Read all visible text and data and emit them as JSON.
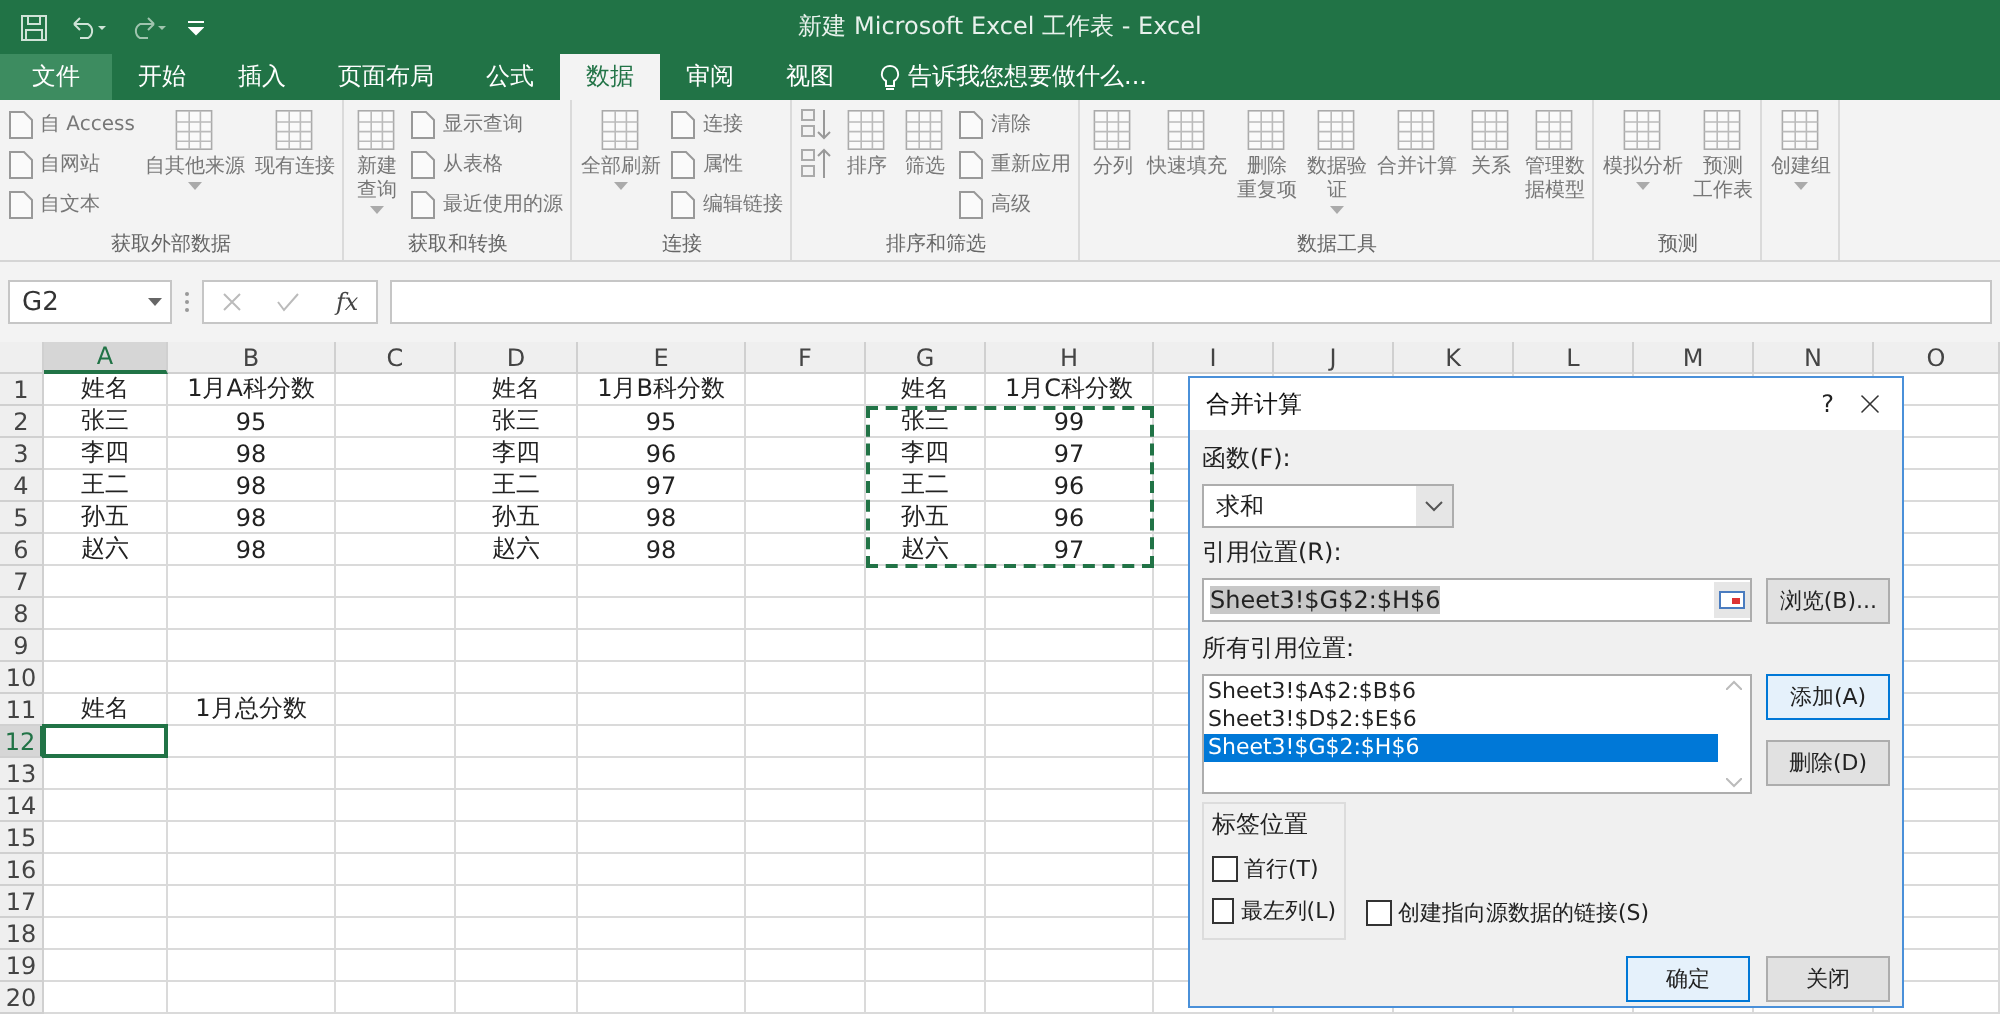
{
  "window": {
    "title": "新建 Microsoft Excel 工作表 - Excel"
  },
  "tabs": [
    {
      "label": "文件",
      "kind": "file",
      "selected": false
    },
    {
      "label": "开始",
      "kind": "tab",
      "selected": false
    },
    {
      "label": "插入",
      "kind": "tab",
      "selected": false
    },
    {
      "label": "页面布局",
      "kind": "tab",
      "selected": false
    },
    {
      "label": "公式",
      "kind": "tab",
      "selected": false
    },
    {
      "label": "数据",
      "kind": "tab",
      "selected": true
    },
    {
      "label": "审阅",
      "kind": "tab",
      "selected": false
    },
    {
      "label": "视图",
      "kind": "tab",
      "selected": false
    }
  ],
  "tell_me": {
    "placeholder": "告诉我您想要做什么..."
  },
  "ribbon": [
    {
      "label": "获取外部数据",
      "items": [
        {
          "kind": "stack",
          "items": [
            "自 Access",
            "自网站",
            "自文本"
          ]
        },
        {
          "kind": "big",
          "label": "自其他来源",
          "dropdown": true
        },
        {
          "kind": "big",
          "label": "现有连接",
          "dropdown": false
        }
      ]
    },
    {
      "label": "获取和转换",
      "items": [
        {
          "kind": "big",
          "lines": [
            "新建",
            "查询"
          ],
          "dropdown": true
        },
        {
          "kind": "stack",
          "items": [
            "显示查询",
            "从表格",
            "最近使用的源"
          ]
        }
      ]
    },
    {
      "label": "连接",
      "items": [
        {
          "kind": "big",
          "label": "全部刷新",
          "dropdown": true
        },
        {
          "kind": "stack",
          "items": [
            "连接",
            "属性",
            "编辑链接"
          ]
        }
      ]
    },
    {
      "label": "排序和筛选",
      "items": [
        {
          "kind": "sort"
        },
        {
          "kind": "big",
          "label": "排序",
          "dropdown": false
        },
        {
          "kind": "big",
          "label": "筛选",
          "dropdown": false
        },
        {
          "kind": "stack",
          "items": [
            "清除",
            "重新应用",
            "高级"
          ]
        }
      ]
    },
    {
      "label": "数据工具",
      "items": [
        {
          "kind": "big",
          "label": "分列",
          "dropdown": false
        },
        {
          "kind": "big",
          "label": "快速填充",
          "dropdown": false
        },
        {
          "kind": "big",
          "lines": [
            "删除",
            "重复项"
          ],
          "dropdown": false
        },
        {
          "kind": "big",
          "lines": [
            "数据验",
            "证"
          ],
          "dropdown": true
        },
        {
          "kind": "big",
          "label": "合并计算",
          "dropdown": false
        },
        {
          "kind": "big",
          "label": "关系",
          "dropdown": false
        },
        {
          "kind": "big",
          "lines": [
            "管理数",
            "据模型"
          ],
          "dropdown": false
        }
      ]
    },
    {
      "label": "预测",
      "items": [
        {
          "kind": "big",
          "label": "模拟分析",
          "dropdown": true
        },
        {
          "kind": "big",
          "lines": [
            "预测",
            "工作表"
          ],
          "dropdown": false
        }
      ]
    },
    {
      "items": [
        {
          "kind": "big",
          "label": "创建组",
          "dropdown": true
        }
      ]
    }
  ],
  "formula_bar": {
    "name_box": "G2",
    "fx": "fx"
  },
  "sheet": {
    "columns": [
      {
        "label": "A",
        "selected": true,
        "marquee": false
      },
      {
        "label": "B",
        "selected": false,
        "marquee": false
      },
      {
        "label": "C",
        "selected": false,
        "marquee": false
      },
      {
        "label": "D",
        "selected": false,
        "marquee": false
      },
      {
        "label": "E",
        "selected": false,
        "marquee": false
      },
      {
        "label": "F",
        "selected": false,
        "marquee": false
      },
      {
        "label": "G",
        "selected": false,
        "marquee": true
      },
      {
        "label": "H",
        "selected": false,
        "marquee": true
      },
      {
        "label": "I",
        "selected": false,
        "marquee": false
      },
      {
        "label": "J",
        "selected": false,
        "marquee": false
      },
      {
        "label": "K",
        "selected": false,
        "marquee": false
      },
      {
        "label": "L",
        "selected": false,
        "marquee": false
      },
      {
        "label": "M",
        "selected": false,
        "marquee": false
      },
      {
        "label": "N",
        "selected": false,
        "marquee": false
      },
      {
        "label": "O",
        "selected": false,
        "marquee": false
      }
    ],
    "rows": [
      {
        "label": "1",
        "selected": false,
        "marquee": false,
        "cells": [
          "姓名",
          "1月A科分数",
          null,
          "姓名",
          "1月B科分数",
          null,
          "姓名",
          "1月C科分数"
        ]
      },
      {
        "label": "2",
        "selected": false,
        "marquee": true,
        "cells": [
          "张三",
          "95",
          null,
          "张三",
          "95",
          null,
          "张三",
          "99"
        ]
      },
      {
        "label": "3",
        "selected": false,
        "marquee": true,
        "cells": [
          "李四",
          "98",
          null,
          "李四",
          "96",
          null,
          "李四",
          "97"
        ]
      },
      {
        "label": "4",
        "selected": false,
        "marquee": true,
        "cells": [
          "王二",
          "98",
          null,
          "王二",
          "97",
          null,
          "王二",
          "96"
        ]
      },
      {
        "label": "5",
        "selected": false,
        "marquee": true,
        "cells": [
          "孙五",
          "98",
          null,
          "孙五",
          "98",
          null,
          "孙五",
          "96"
        ]
      },
      {
        "label": "6",
        "selected": false,
        "marquee": true,
        "cells": [
          "赵六",
          "98",
          null,
          "赵六",
          "98",
          null,
          "赵六",
          "97"
        ]
      },
      {
        "label": "7",
        "selected": false,
        "marquee": false
      },
      {
        "label": "8",
        "selected": false,
        "marquee": false
      },
      {
        "label": "9",
        "selected": false,
        "marquee": false
      },
      {
        "label": "10",
        "selected": false,
        "marquee": false
      },
      {
        "label": "11",
        "selected": false,
        "marquee": false,
        "cells": [
          "姓名",
          "1月总分数"
        ]
      },
      {
        "label": "12",
        "selected": true,
        "marquee": false
      },
      {
        "label": "13",
        "selected": false,
        "marquee": false
      },
      {
        "label": "14",
        "selected": false,
        "marquee": false
      },
      {
        "label": "15",
        "selected": false,
        "marquee": false
      },
      {
        "label": "16",
        "selected": false,
        "marquee": false
      },
      {
        "label": "17",
        "selected": false,
        "marquee": false
      },
      {
        "label": "18",
        "selected": false,
        "marquee": false
      },
      {
        "label": "19",
        "selected": false,
        "marquee": false
      },
      {
        "label": "20",
        "selected": false,
        "marquee": false
      }
    ]
  },
  "dialog": {
    "title": "合并计算",
    "help": "?",
    "function_label": "函数(F):",
    "function_value": "求和",
    "reference_label": "引用位置(R):",
    "reference_value": "Sheet3!$G$2:$H$6",
    "reference_selected": true,
    "browse_button": {
      "label": "浏览(B)...",
      "highlighted": false
    },
    "all_references_label": "所有引用位置:",
    "references": [
      {
        "text": "Sheet3!$A$2:$B$6",
        "selected": false
      },
      {
        "text": "Sheet3!$D$2:$E$6",
        "selected": false
      },
      {
        "text": "Sheet3!$G$2:$H$6",
        "selected": true
      }
    ],
    "add_button": {
      "label": "添加(A)",
      "highlighted": true
    },
    "delete_button": {
      "label": "删除(D)",
      "highlighted": false
    },
    "label_group": "标签位置",
    "label_options": [
      {
        "label": "首行(T)",
        "checked": false
      },
      {
        "label": "最左列(L)",
        "checked": false
      }
    ],
    "link_option": {
      "label": "创建指向源数据的链接(S)",
      "checked": false
    },
    "ok_button": {
      "label": "确定",
      "highlighted": true
    },
    "close_button": {
      "label": "关闭",
      "highlighted": false
    }
  }
}
